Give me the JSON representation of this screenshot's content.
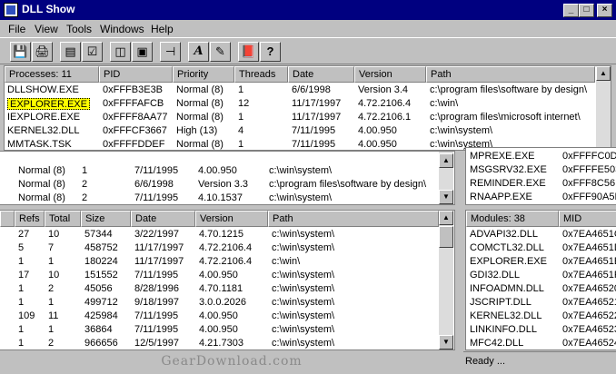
{
  "window": {
    "title": "DLL Show",
    "minimize": "_",
    "maximize": "□",
    "close": "×"
  },
  "menu": {
    "file": "File",
    "view": "View",
    "tools": "Tools",
    "windows": "Windows",
    "help": "Help"
  },
  "toolbar": {
    "buttons": [
      {
        "icon": "save-icon",
        "glyph": "💾"
      },
      {
        "icon": "print-icon",
        "glyph": "🖨"
      },
      {
        "icon": "report-icon",
        "glyph": "▤"
      },
      {
        "icon": "properties-icon",
        "glyph": "☑"
      },
      {
        "icon": "window-list-icon",
        "glyph": "◫"
      },
      {
        "icon": "monitor-icon",
        "glyph": "▣"
      },
      {
        "icon": "pin-icon",
        "glyph": "⊣"
      },
      {
        "icon": "font-icon",
        "glyph": "A"
      },
      {
        "icon": "edit-text-icon",
        "glyph": "✎"
      },
      {
        "icon": "book-icon",
        "glyph": "📕"
      },
      {
        "icon": "help-icon",
        "glyph": "?"
      }
    ]
  },
  "processes": {
    "headers": [
      "Processes: 11",
      "PID",
      "Priority",
      "Threads",
      "Date",
      "Version",
      "Path"
    ],
    "rows": [
      [
        "DLLSHOW.EXE",
        "0xFFFB3E3B",
        "Normal (8)",
        "1",
        "6/6/1998",
        "Version 3.4",
        "c:\\program files\\software by design\\"
      ],
      [
        "EXPLORER.EXE",
        "0xFFFFAFCB",
        "Normal (8)",
        "12",
        "11/17/1997",
        "4.72.2106.4",
        "c:\\win\\"
      ],
      [
        "IEXPLORE.EXE",
        "0xFFFF8AA77",
        "Normal (8)",
        "1",
        "11/17/1997",
        "4.72.2106.1",
        "c:\\program files\\microsoft internet\\"
      ],
      [
        "KERNEL32.DLL",
        "0xFFFCF3667",
        "High (13)",
        "4",
        "7/11/1995",
        "4.00.950",
        "c:\\win\\system\\"
      ],
      [
        "MMTASK.TSK",
        "0xFFFFDDEF",
        "Normal (8)",
        "1",
        "7/11/1995",
        "4.00.950",
        "c:\\win\\system\\"
      ]
    ]
  },
  "lower_processes": {
    "rows": [
      [
        "Normal (8)",
        "1",
        "7/11/1995",
        "4.00.950",
        "c:\\win\\system\\"
      ],
      [
        "Normal (8)",
        "2",
        "6/6/1998",
        "Version 3.3",
        "c:\\program files\\software by design\\"
      ],
      [
        "Normal (8)",
        "2",
        "7/11/1995",
        "4.10.1537",
        "c:\\win\\system\\"
      ]
    ]
  },
  "right_processes": {
    "rows": [
      [
        "MPREXE.EXE",
        "0xFFFFC0D5"
      ],
      [
        "MSGSRV32.EXE",
        "0xFFFFE503"
      ],
      [
        "REMINDER.EXE",
        "0xFFF8C56E"
      ],
      [
        "RNAAPP.EXE",
        "0xFFF90A5E"
      ]
    ]
  },
  "dll_table": {
    "headers": [
      "Refs",
      "Total",
      "Size",
      "Date",
      "Version",
      "Path"
    ],
    "rows": [
      [
        "27",
        "10",
        "57344",
        "3/22/1997",
        "4.70.1215",
        "c:\\win\\system\\"
      ],
      [
        "5",
        "7",
        "458752",
        "11/17/1997",
        "4.72.2106.4",
        "c:\\win\\system\\"
      ],
      [
        "1",
        "1",
        "180224",
        "11/17/1997",
        "4.72.2106.4",
        "c:\\win\\"
      ],
      [
        "17",
        "10",
        "151552",
        "7/11/1995",
        "4.00.950",
        "c:\\win\\system\\"
      ],
      [
        "1",
        "2",
        "45056",
        "8/28/1996",
        "4.70.1181",
        "c:\\win\\system\\"
      ],
      [
        "1",
        "1",
        "499712",
        "9/18/1997",
        "3.0.0.2026",
        "c:\\win\\system\\"
      ],
      [
        "109",
        "11",
        "425984",
        "7/11/1995",
        "4.00.950",
        "c:\\win\\system\\"
      ],
      [
        "1",
        "1",
        "36864",
        "7/11/1995",
        "4.00.950",
        "c:\\win\\system\\"
      ],
      [
        "1",
        "2",
        "966656",
        "12/5/1997",
        "4.21.7303",
        "c:\\win\\system\\"
      ]
    ]
  },
  "modules": {
    "headers": [
      "Modules: 38",
      "MID"
    ],
    "rows": [
      [
        "ADVAPI32.DLL",
        "0x7EA4651C"
      ],
      [
        "COMCTL32.DLL",
        "0x7EA4651D"
      ],
      [
        "EXPLORER.EXE",
        "0x7EA4651E"
      ],
      [
        "GDI32.DLL",
        "0x7EA4651F"
      ],
      [
        "INFOADMN.DLL",
        "0x7EA46520"
      ],
      [
        "JSCRIPT.DLL",
        "0x7EA46521"
      ],
      [
        "KERNEL32.DLL",
        "0x7EA46522"
      ],
      [
        "LINKINFO.DLL",
        "0x7EA46523"
      ],
      [
        "MFC42.DLL",
        "0x7EA46524"
      ]
    ]
  },
  "status": {
    "text": "Ready ..."
  },
  "watermark": "GearDownload.com"
}
